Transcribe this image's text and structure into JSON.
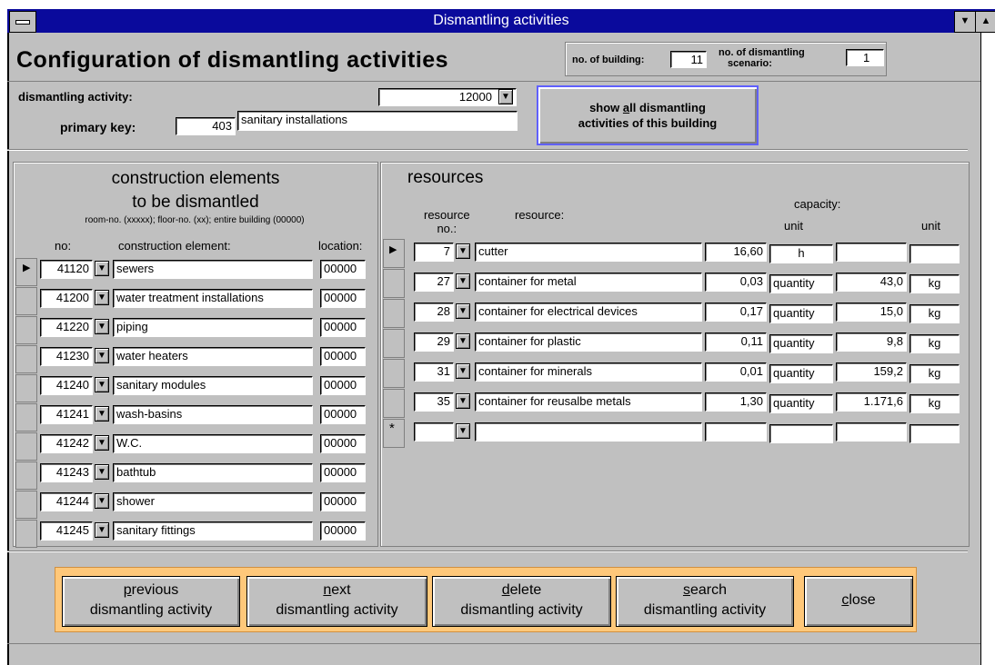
{
  "window": {
    "title": "Dismantling activities"
  },
  "header": {
    "heading": "Configuration of dismantling activities",
    "building_label": "no. of building:",
    "building_value": "11",
    "scenario_label_1": "no. of dismantling",
    "scenario_label_2": "scenario:",
    "scenario_value": "1"
  },
  "activity": {
    "label": "dismantling activity:",
    "code": "12000",
    "primary_key_label": "primary key:",
    "primary_key": "403",
    "name": "sanitary installations",
    "show_all_line1_pre": "show ",
    "show_all_line1_u": "a",
    "show_all_line1_post": "ll dismantling",
    "show_all_line2": "activities of this building"
  },
  "elements": {
    "title1": "construction elements",
    "title2": "to be dismantled",
    "hint": "room-no. (xxxxx); floor-no. (xx); entire building (00000)",
    "col_no": "no:",
    "col_element": "construction element:",
    "col_location": "location:",
    "rows": [
      {
        "no": "41120",
        "element": "sewers",
        "location": "00000"
      },
      {
        "no": "41200",
        "element": "water treatment installations",
        "location": "00000"
      },
      {
        "no": "41220",
        "element": "piping",
        "location": "00000"
      },
      {
        "no": "41230",
        "element": "water heaters",
        "location": "00000"
      },
      {
        "no": "41240",
        "element": "sanitary modules",
        "location": "00000"
      },
      {
        "no": "41241",
        "element": "wash-basins",
        "location": "00000"
      },
      {
        "no": "41242",
        "element": "W.C.",
        "location": "00000"
      },
      {
        "no": "41243",
        "element": "bathtub",
        "location": "00000"
      },
      {
        "no": "41244",
        "element": "shower",
        "location": "00000"
      },
      {
        "no": "41245",
        "element": "sanitary fittings",
        "location": "00000"
      }
    ]
  },
  "resources": {
    "title": "resources",
    "col_no_1": "resource",
    "col_no_2": "no.:",
    "col_resource": "resource:",
    "col_capacity": "capacity:",
    "col_unit1": "unit",
    "col_unit2": "unit",
    "new_marker": "*",
    "rows": [
      {
        "no": "7",
        "name": "cutter",
        "cap": "16,60",
        "unit": "h",
        "qty": "",
        "unit2": ""
      },
      {
        "no": "27",
        "name": "container for metal",
        "cap": "0,03",
        "unit": "quantity",
        "qty": "43,0",
        "unit2": "kg"
      },
      {
        "no": "28",
        "name": "container for electrical devices",
        "cap": "0,17",
        "unit": "quantity",
        "qty": "15,0",
        "unit2": "kg"
      },
      {
        "no": "29",
        "name": "container for plastic",
        "cap": "0,11",
        "unit": "quantity",
        "qty": "9,8",
        "unit2": "kg"
      },
      {
        "no": "31",
        "name": "container for minerals",
        "cap": "0,01",
        "unit": "quantity",
        "qty": "159,2",
        "unit2": "kg"
      },
      {
        "no": "35",
        "name": "container for reusalbe metals",
        "cap": "1,30",
        "unit": "quantity",
        "qty": "1.171,6",
        "unit2": "kg"
      }
    ]
  },
  "footer": {
    "prev_u": "p",
    "prev_rest": "revious",
    "prev_line2": "dismantling activity",
    "next_u": "n",
    "next_rest": "ext",
    "next_line2": "dismantling activity",
    "delete_u": "d",
    "delete_rest": "elete",
    "delete_line2": "dismantling activity",
    "search_u": "s",
    "search_rest": "earch",
    "search_line2": "dismantling activity",
    "close_u": "c",
    "close_rest": "lose"
  },
  "colors": {
    "titlebar": "#0a0a9c",
    "form": "#c0c0c0",
    "footer_panel": "#ffc87a"
  }
}
